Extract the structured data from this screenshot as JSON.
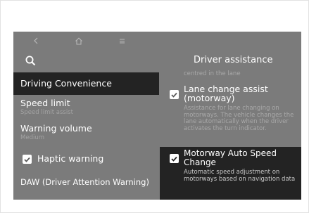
{
  "nav": {
    "back_icon": "chevron-left-icon",
    "home_icon": "home-icon",
    "menu_icon": "menu-icon"
  },
  "left_panel": {
    "search_icon": "search-icon",
    "selected_item": "Driving Convenience",
    "speed_limit": {
      "label": "Speed limit",
      "sub": "Speed limit assist"
    },
    "warning_volume": {
      "label": "Warning volume",
      "sub": "Medium"
    },
    "haptic_warning": {
      "label": "Haptic warning",
      "checked": true
    },
    "daw": {
      "label": "DAW (Driver Attention Warning)"
    }
  },
  "right_panel": {
    "title": "Driver assistance",
    "cut_text": "centred in the lane",
    "lane_change": {
      "title": "Lane change assist (motorway)",
      "desc": "Assistance for lane changing on motorways. The vehicle changes the lane automatically when the driver activates the turn indicator.",
      "checked": true
    },
    "motorway_auto_speed": {
      "title": "Motorway Auto Speed Change",
      "desc": "Automatic speed adjustment on motorways based on navigation data",
      "checked": true
    }
  },
  "colors": {
    "screen_bg": "#7b7b7b",
    "selected_bg": "#232323",
    "text": "#ffffff",
    "muted_text": "#a8a8a8"
  }
}
